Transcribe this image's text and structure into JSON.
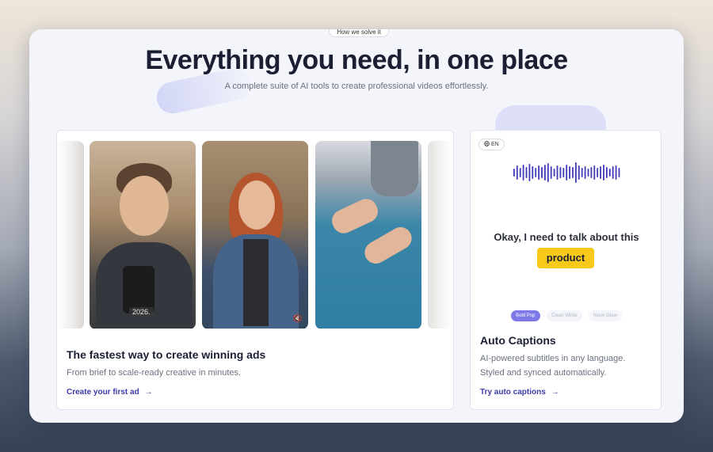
{
  "section_tag": "How we solve it",
  "headline": "Everything you need, in one place",
  "subheadline": "A complete suite of AI tools to create professional videos effortlessly.",
  "left_card": {
    "title": "The fastest way to create winning ads",
    "description": "From brief to scale-ready creative in minutes.",
    "link": "Create your first ad",
    "link_arrow": "→",
    "photo_year_label": "2026.",
    "photo_mute_icon": "🔇"
  },
  "right_card": {
    "language": "EN",
    "caption_text": "Okay, I need to talk about this",
    "caption_highlight": "product",
    "styles": [
      "Bold Pop",
      "Clean White",
      "Neon Glow"
    ],
    "active_style": "Bold Pop",
    "title": "Auto Captions",
    "description_line1": "AI-powered subtitles in any language.",
    "description_line2": "Styled and synced automatically.",
    "link": "Try auto captions",
    "link_arrow": "→"
  },
  "colors": {
    "accent": "#3d3aa8",
    "waveform": "#3f3bb5",
    "highlight": "#f7c919",
    "active_chip": "#7d79e8"
  },
  "icons": {
    "language": "globe-icon",
    "arrow": "arrow-right-icon",
    "mute": "mute-icon"
  }
}
